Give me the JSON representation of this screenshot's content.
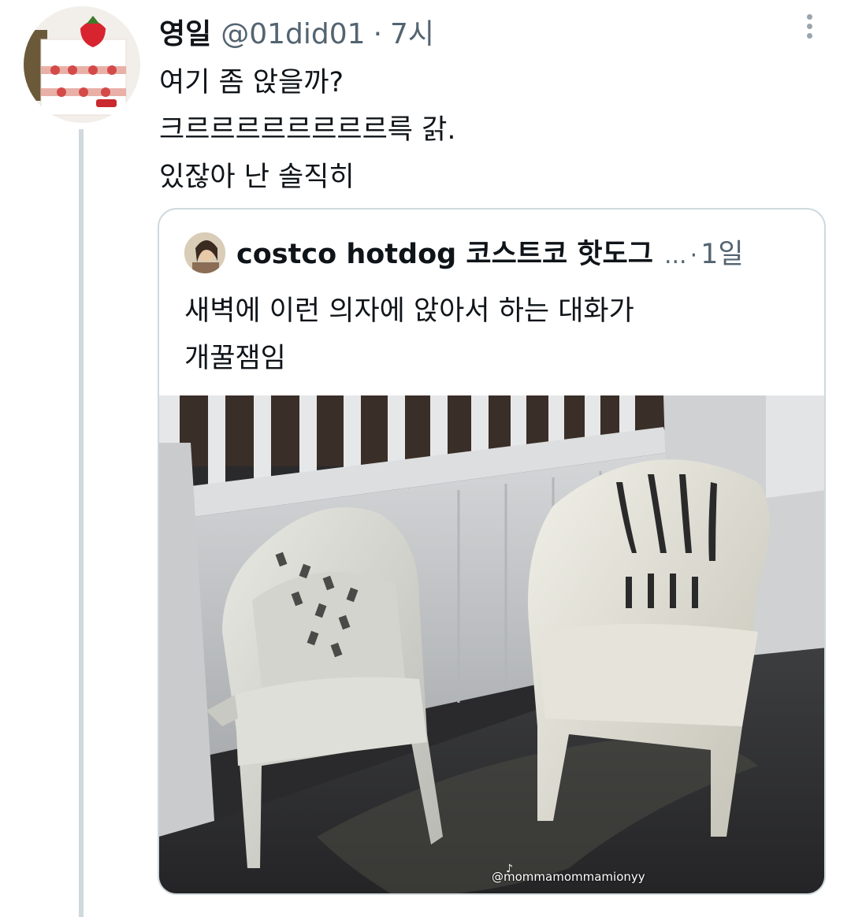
{
  "author": {
    "name": "영일",
    "handle": "@01did01",
    "separator": "·",
    "time": "7시"
  },
  "tweet": {
    "lines": [
      "여기 좀 앉을까?",
      "크르르르르르르르르륵 갉.",
      "있잖아 난 솔직히"
    ]
  },
  "quoted": {
    "name": "costco hotdog 코스트코 핫도그",
    "ellipsis": "...",
    "separator": "·",
    "time": "1일",
    "lines": [
      "새벽에 이런 의자에 앉아서 하는 대화가",
      "개꿀잼임"
    ],
    "photo_watermark": "@mommamommamionyy"
  },
  "icons": [
    "more-vertical-icon",
    "tiktok-icon"
  ]
}
